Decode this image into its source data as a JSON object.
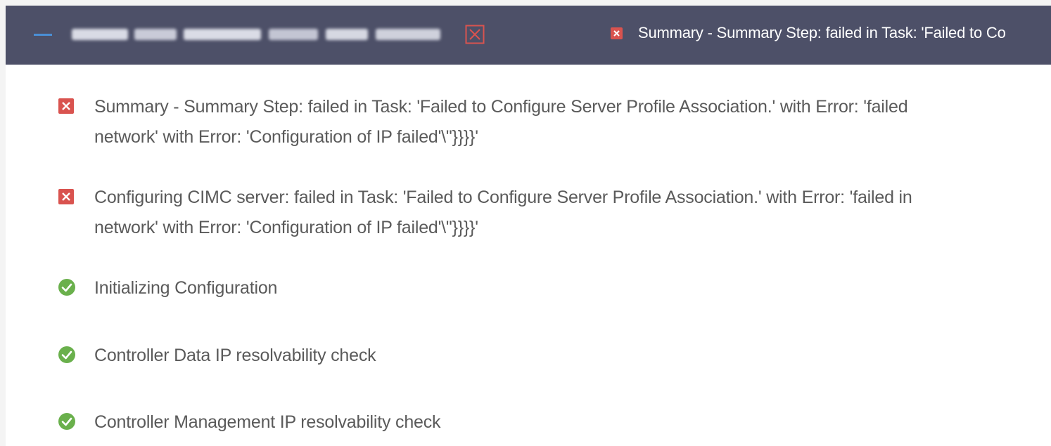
{
  "header": {
    "collapse_icon": "minus-icon",
    "node_name_icon": "blurred-node-name",
    "node_close_icon": "close-box-icon",
    "status_icon": "error-icon",
    "status_text": "Summary - Summary Step: failed in Task: 'Failed to Co",
    "colors": {
      "background": "#4d5068",
      "accent": "#4a8fd6",
      "error": "#d9534f"
    }
  },
  "steps": [
    {
      "status": "error",
      "icon": "error-icon",
      "text": "Summary - Summary Step: failed in Task: 'Failed to Configure Server Profile Association.' with Error: 'failed\nnetwork' with Error: 'Configuration of IP failed'\\\"}}}}'"
    },
    {
      "status": "error",
      "icon": "error-icon",
      "text": "Configuring CIMC server: failed in Task: 'Failed to Configure Server Profile Association.' with Error: 'failed in\nnetwork' with Error: 'Configuration of IP failed'\\\"}}}}'"
    },
    {
      "status": "success",
      "icon": "check-circle-icon",
      "text": "Initializing Configuration"
    },
    {
      "status": "success",
      "icon": "check-circle-icon",
      "text": "Controller Data IP resolvability check"
    },
    {
      "status": "success",
      "icon": "check-circle-icon",
      "text": "Controller Management IP resolvability check"
    }
  ],
  "colors": {
    "error": "#d9534f",
    "success": "#6ab04c",
    "text": "#5a5a5a"
  }
}
